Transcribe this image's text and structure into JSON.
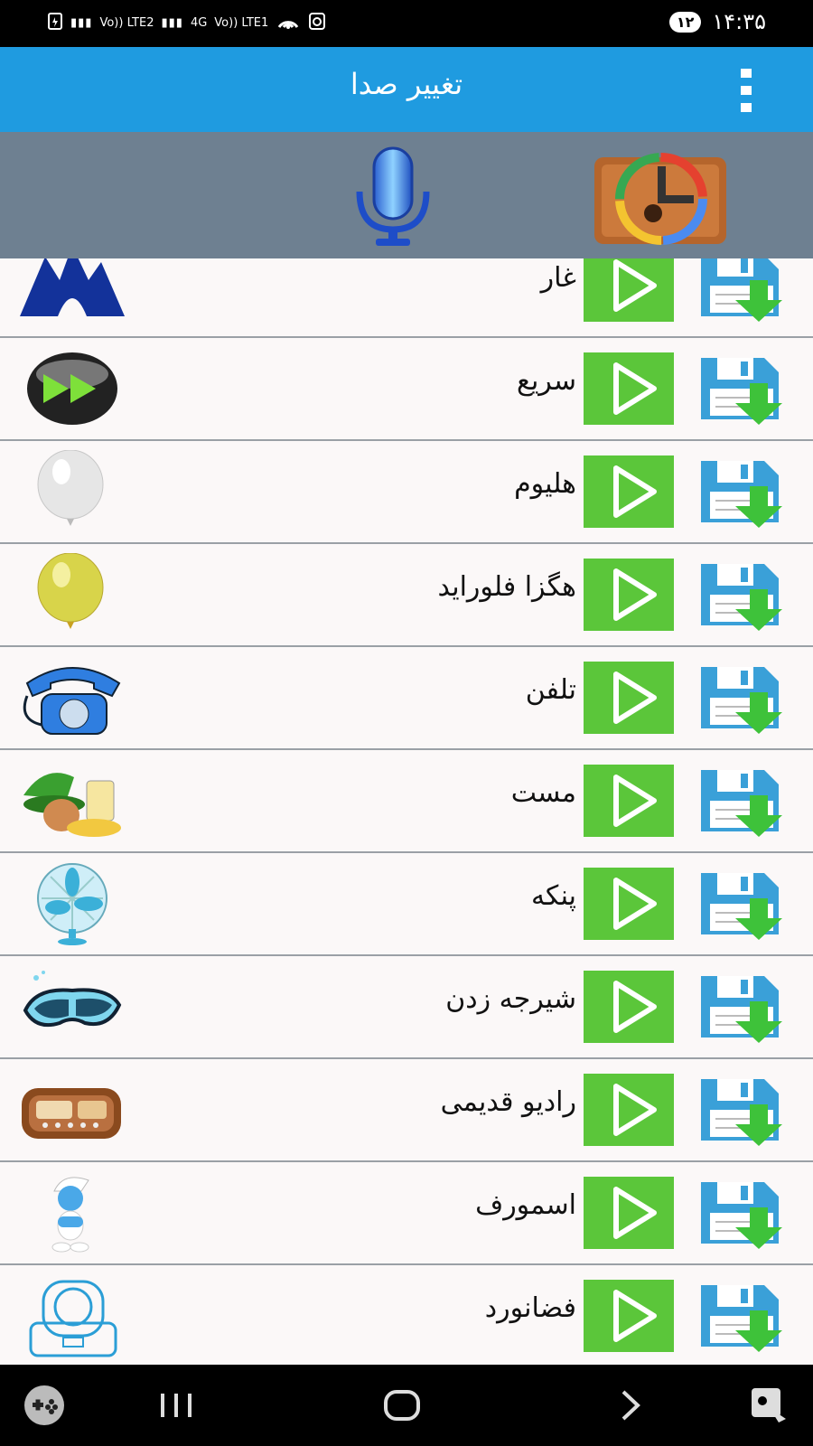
{
  "status_bar": {
    "network_indicators": [
      "Vo)) LTE2",
      "Vo)) LTE1",
      "4G"
    ],
    "notification_count": "۱۲",
    "time": "۱۴:۳۵"
  },
  "app_bar": {
    "title": "تغییر صدا"
  },
  "toolbar": {
    "record_icon": "microphone-icon",
    "open_file_icon": "music-history-icon"
  },
  "effects": [
    {
      "label": "غار",
      "icon": "cave-icon"
    },
    {
      "label": "سریع",
      "icon": "fast-forward-icon"
    },
    {
      "label": "هلیوم",
      "icon": "white-balloon-icon"
    },
    {
      "label": "هگزا فلوراید",
      "icon": "yellow-balloon-icon"
    },
    {
      "label": "تلفن",
      "icon": "telephone-icon"
    },
    {
      "label": "مست",
      "icon": "drunk-icon"
    },
    {
      "label": "پنکه",
      "icon": "fan-icon"
    },
    {
      "label": "شیرجه زدن",
      "icon": "diving-mask-icon"
    },
    {
      "label": "رادیو قدیمی",
      "icon": "old-radio-icon"
    },
    {
      "label": "اسمورف",
      "icon": "smurf-icon"
    },
    {
      "label": "فضانورد",
      "icon": "astronaut-icon"
    }
  ],
  "colors": {
    "app_bar": "#1f9be0",
    "toolbar": "#6e8091",
    "play_button": "#5bc63a",
    "save_icon": "#3aa0d8",
    "list_background": "#fbf8f8"
  },
  "nav_bar": {
    "items": [
      "game-icon",
      "recents-icon",
      "home-icon",
      "back-icon",
      "screenshot-icon"
    ]
  }
}
